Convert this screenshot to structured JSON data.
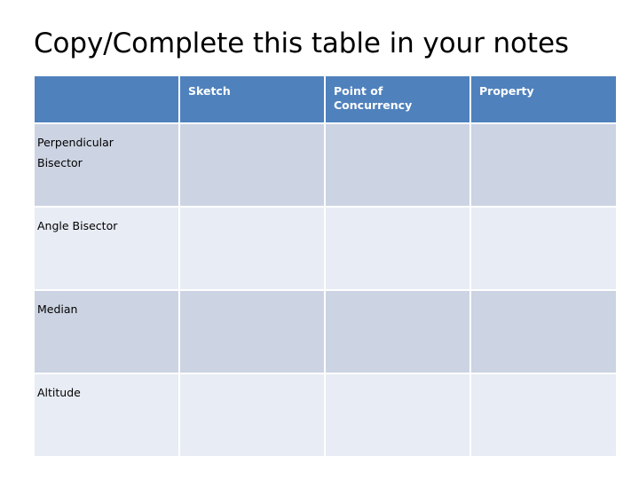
{
  "slide": {
    "title": "Copy/Complete this table in your notes",
    "background_color": "#ffffff"
  },
  "table": {
    "header_background": "#4f81bd",
    "header_text_color": "#ffffff",
    "band_dark": "#ccd3e2",
    "band_light": "#e8ecf4",
    "columns": [
      {
        "key": "name",
        "label": ""
      },
      {
        "key": "sketch",
        "label": "Sketch"
      },
      {
        "key": "point_of_concurrency",
        "label": "Point of\nConcurrency"
      },
      {
        "key": "property",
        "label": "Property"
      }
    ],
    "rows": [
      {
        "name": "Perpendicular\nBisector",
        "sketch": "",
        "point_of_concurrency": "",
        "property": ""
      },
      {
        "name": "Angle Bisector",
        "sketch": "",
        "point_of_concurrency": "",
        "property": ""
      },
      {
        "name": "Median",
        "sketch": "",
        "point_of_concurrency": "",
        "property": ""
      },
      {
        "name": "Altitude",
        "sketch": "",
        "point_of_concurrency": "",
        "property": ""
      }
    ]
  }
}
